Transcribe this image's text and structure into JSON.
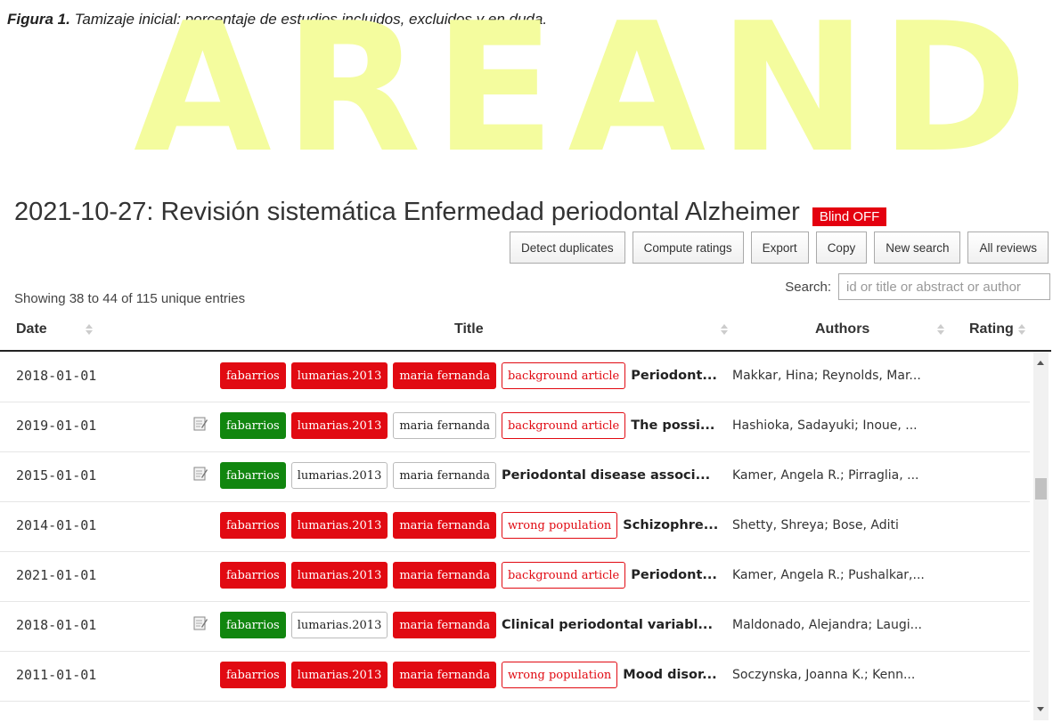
{
  "figure_caption": {
    "label": "Figura 1.",
    "text": " Tamizaje inicial: porcentaje de estudios incluidos, excluidos y en duda."
  },
  "watermark": {
    "text": "AREANDINA"
  },
  "page": {
    "title": "2021-10-27: Revisión sistemática Enfermedad periodontal Alzheimer",
    "blind_badge": "Blind OFF"
  },
  "toolbar": {
    "detect_duplicates": "Detect duplicates",
    "compute_ratings": "Compute ratings",
    "export": "Export",
    "copy": "Copy",
    "new_search": "New search",
    "all_reviews": "All reviews"
  },
  "info": {
    "showing": "Showing 38 to 44 of 115 unique entries"
  },
  "search": {
    "label": "Search:",
    "placeholder": "id or title or abstract or author"
  },
  "table": {
    "columns": {
      "date": "Date",
      "title": "Title",
      "authors": "Authors",
      "rating": "Rating"
    },
    "rows": [
      {
        "date": "2018-01-01",
        "has_note": false,
        "tags": [
          {
            "text": "fabarrios",
            "style": "red"
          },
          {
            "text": "lumarias.2013",
            "style": "red"
          },
          {
            "text": "maria fernanda",
            "style": "red"
          },
          {
            "text": "background article",
            "style": "outline"
          }
        ],
        "title": "Periodont...",
        "authors": "Makkar, Hina; Reynolds, Mar..."
      },
      {
        "date": "2019-01-01",
        "has_note": true,
        "tags": [
          {
            "text": "fabarrios",
            "style": "green"
          },
          {
            "text": "lumarias.2013",
            "style": "red"
          },
          {
            "text": "maria fernanda",
            "style": "white"
          },
          {
            "text": "background article",
            "style": "outline"
          }
        ],
        "title": "The possi...",
        "authors": "Hashioka, Sadayuki; Inoue, ..."
      },
      {
        "date": "2015-01-01",
        "has_note": true,
        "tags": [
          {
            "text": "fabarrios",
            "style": "green"
          },
          {
            "text": "lumarias.2013",
            "style": "white"
          },
          {
            "text": "maria fernanda",
            "style": "white"
          }
        ],
        "title": "Periodontal disease associ...",
        "authors": "Kamer, Angela R.; Pirraglia, ..."
      },
      {
        "date": "2014-01-01",
        "has_note": false,
        "tags": [
          {
            "text": "fabarrios",
            "style": "red"
          },
          {
            "text": "lumarias.2013",
            "style": "red"
          },
          {
            "text": "maria fernanda",
            "style": "red"
          },
          {
            "text": "wrong population",
            "style": "outline"
          }
        ],
        "title": "Schizophre...",
        "authors": "Shetty, Shreya; Bose, Aditi"
      },
      {
        "date": "2021-01-01",
        "has_note": false,
        "tags": [
          {
            "text": "fabarrios",
            "style": "red"
          },
          {
            "text": "lumarias.2013",
            "style": "red"
          },
          {
            "text": "maria fernanda",
            "style": "red"
          },
          {
            "text": "background article",
            "style": "outline"
          }
        ],
        "title": "Periodont...",
        "authors": "Kamer, Angela R.; Pushalkar,..."
      },
      {
        "date": "2018-01-01",
        "has_note": true,
        "tags": [
          {
            "text": "fabarrios",
            "style": "green"
          },
          {
            "text": "lumarias.2013",
            "style": "white"
          },
          {
            "text": "maria fernanda",
            "style": "red"
          }
        ],
        "title": "Clinical periodontal variabl...",
        "authors": "Maldonado, Alejandra; Laugi..."
      },
      {
        "date": "2011-01-01",
        "has_note": false,
        "tags": [
          {
            "text": "fabarrios",
            "style": "red"
          },
          {
            "text": "lumarias.2013",
            "style": "red"
          },
          {
            "text": "maria fernanda",
            "style": "red"
          },
          {
            "text": "wrong population",
            "style": "outline"
          }
        ],
        "title": "Mood disor...",
        "authors": "Soczynska, Joanna K.; Kenn..."
      }
    ]
  },
  "colors": {
    "tag_red": "#e10a12",
    "tag_green": "#11860f",
    "watermark": "#f4fc9e",
    "blind_badge": "#e4000f"
  }
}
